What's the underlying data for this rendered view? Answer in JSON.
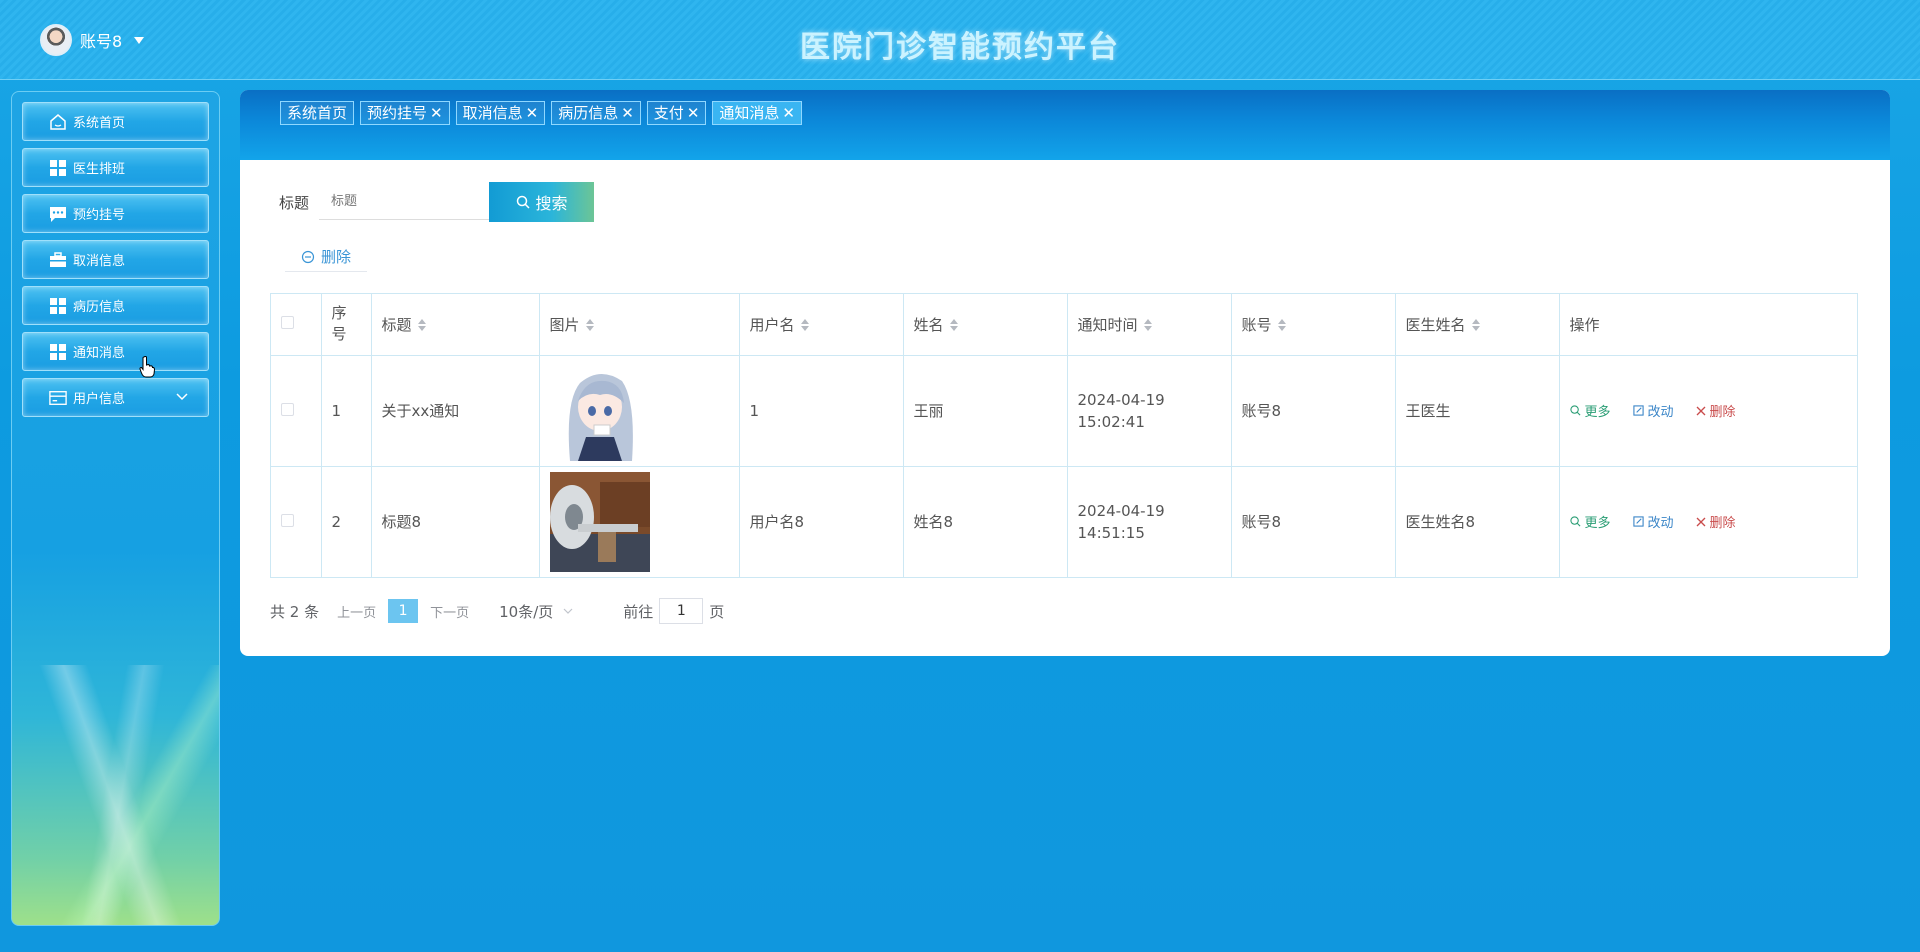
{
  "header": {
    "title": "医院门诊智能预约平台",
    "user_name": "账号8"
  },
  "sidebar": {
    "items": [
      {
        "label": "系统首页",
        "icon": "home-icon"
      },
      {
        "label": "医生排班",
        "icon": "grid-icon"
      },
      {
        "label": "预约挂号",
        "icon": "chat-icon"
      },
      {
        "label": "取消信息",
        "icon": "briefcase-icon"
      },
      {
        "label": "病历信息",
        "icon": "grid-icon"
      },
      {
        "label": "通知消息",
        "icon": "grid-icon"
      },
      {
        "label": "用户信息",
        "icon": "card-icon"
      }
    ]
  },
  "tabs": [
    {
      "label": "系统首页",
      "closable": false
    },
    {
      "label": "预约挂号",
      "closable": true
    },
    {
      "label": "取消信息",
      "closable": true
    },
    {
      "label": "病历信息",
      "closable": true
    },
    {
      "label": "支付",
      "closable": true
    },
    {
      "label": "通知消息",
      "closable": true,
      "active": true
    }
  ],
  "search": {
    "label": "标题",
    "placeholder": "标题",
    "button": "搜索"
  },
  "toolbar": {
    "delete_label": "删除"
  },
  "table": {
    "columns": [
      "序号",
      "标题",
      "图片",
      "用户名",
      "姓名",
      "通知时间",
      "账号",
      "医生姓名",
      "操作"
    ],
    "rows": [
      {
        "index": "1",
        "title": "关于xx通知",
        "image": "anime-girl-image",
        "username": "1",
        "name": "王丽",
        "time": "2024-04-19 15:02:41",
        "account": "账号8",
        "doctor": "王医生"
      },
      {
        "index": "2",
        "title": "标题8",
        "image": "mri-room-image",
        "username": "用户名8",
        "name": "姓名8",
        "time": "2024-04-19 14:51:15",
        "account": "账号8",
        "doctor": "医生姓名8"
      }
    ],
    "actions": {
      "more": "更多",
      "edit": "改动",
      "delete": "删除"
    }
  },
  "pagination": {
    "total": "共 2 条",
    "prev": "上一页",
    "page": "1",
    "next": "下一页",
    "page_size": "10条/页",
    "goto_prefix": "前往",
    "goto_value": "1",
    "goto_suffix": "页"
  },
  "colors": {
    "accent": "#1aa6e6",
    "active_page": "#6cc5f0",
    "more": "#2a9d74",
    "edit": "#3b86c8",
    "delete": "#c94c4c"
  }
}
